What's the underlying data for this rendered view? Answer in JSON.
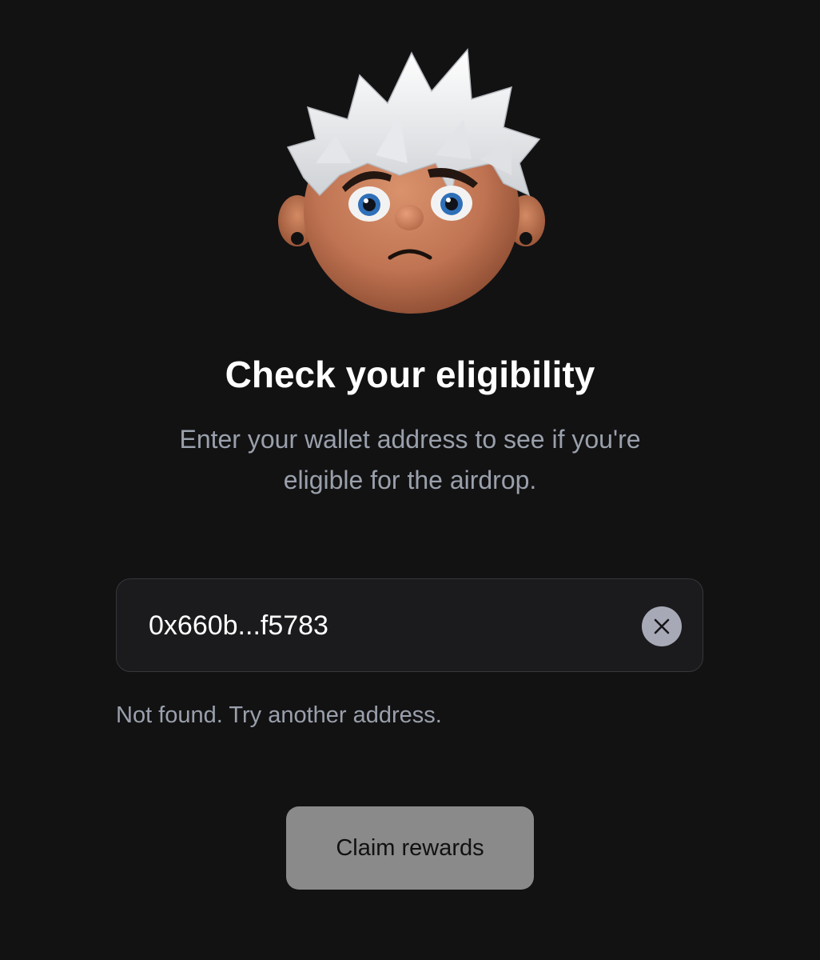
{
  "hero": {
    "avatar_icon": "sad-character-avatar-icon"
  },
  "heading": {
    "title": "Check your eligibility",
    "subtitle_line1": "Enter your wallet address to see if you're",
    "subtitle_line2": "eligible for the airdrop."
  },
  "wallet_input": {
    "value": "0x660b...f5783",
    "clear_icon": "close-icon"
  },
  "status": {
    "message": "Not found. Try another address.",
    "color": "#9aa0ab"
  },
  "claim": {
    "label": "Claim rewards",
    "state": "disabled"
  },
  "colors": {
    "background": "#121213",
    "input_background": "#1b1b1d",
    "button_disabled": "#8a8a8b"
  }
}
